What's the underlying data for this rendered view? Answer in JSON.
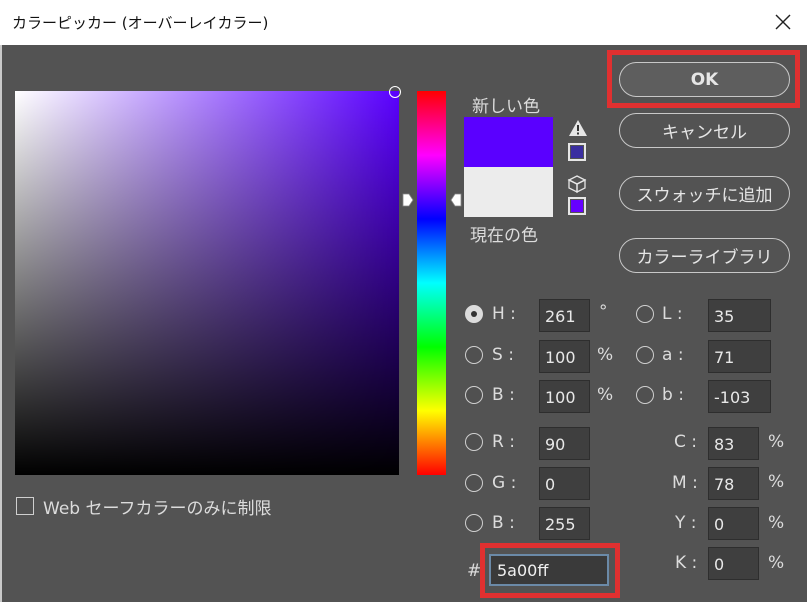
{
  "window": {
    "title": "カラーピッカー (オーバーレイカラー)",
    "close_icon": "close-icon"
  },
  "swatches": {
    "new_label": "新しい色",
    "current_label": "現在の色",
    "new_color": "#5a00ff",
    "current_color": "#ececec",
    "gamut_warning_icon": "warning-triangle-icon",
    "gamut_color": "#3a2ea0",
    "web_safe_icon": "cube-icon",
    "web_safe_color": "#6600ff"
  },
  "buttons": {
    "ok": "OK",
    "cancel": "キャンセル",
    "add_to_swatches": "スウォッチに追加",
    "color_libraries": "カラーライブラリ"
  },
  "hsb": {
    "h_label": "H :",
    "h_value": "261",
    "h_unit": "°",
    "s_label": "S :",
    "s_value": "100",
    "s_unit": "%",
    "b_label": "B :",
    "b_value": "100",
    "b_unit": "%"
  },
  "rgb": {
    "r_label": "R :",
    "r_value": "90",
    "g_label": "G :",
    "g_value": "0",
    "b_label": "B :",
    "b_value": "255"
  },
  "lab": {
    "l_label": "L :",
    "l_value": "35",
    "a_label": "a :",
    "a_value": "71",
    "b_label": "b :",
    "b_value": "-103"
  },
  "cmyk": {
    "c_label": "C :",
    "c_value": "83",
    "c_unit": "%",
    "m_label": "M :",
    "m_value": "78",
    "m_unit": "%",
    "y_label": "Y :",
    "y_value": "0",
    "y_unit": "%",
    "k_label": "K :",
    "k_value": "0",
    "k_unit": "%"
  },
  "hex": {
    "label": "#",
    "value": "5a00ff"
  },
  "web_safe_only_label": "Web セーフカラーのみに制限",
  "highlight_color": "#e03030"
}
